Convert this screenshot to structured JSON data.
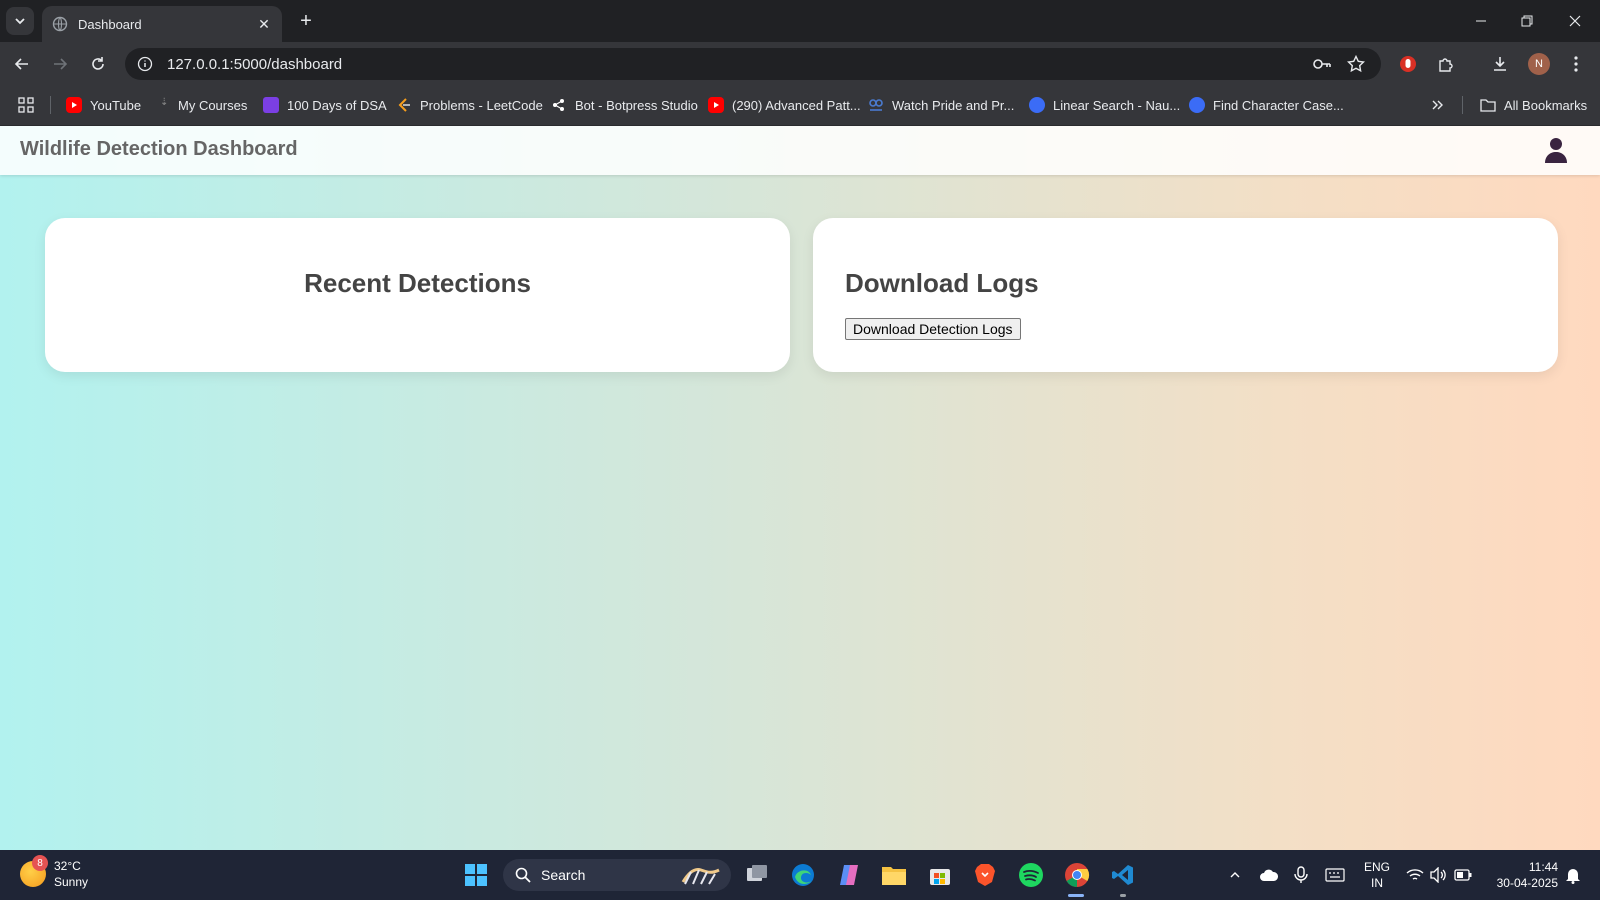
{
  "browser": {
    "tab_title": "Dashboard",
    "url": "127.0.0.1:5000/dashboard",
    "profile_initial": "N",
    "bookmarks": [
      {
        "label": "YouTube",
        "icon": "youtube-icon",
        "color": "#ff0000"
      },
      {
        "label": "My Courses",
        "icon": "courses-icon",
        "color": "#888888"
      },
      {
        "label": "100 Days of DSA",
        "icon": "dsa-icon",
        "color": "#7b3fe4"
      },
      {
        "label": "Problems - LeetCode",
        "icon": "leetcode-icon",
        "color": "#f89f1b"
      },
      {
        "label": "Bot - Botpress Studio",
        "icon": "botpress-icon",
        "color": "#ffffff"
      },
      {
        "label": "(290) Advanced Patt...",
        "icon": "youtube-icon",
        "color": "#ff0000"
      },
      {
        "label": "Watch Pride and Pr...",
        "icon": "watch-icon",
        "color": "#4a7bd0"
      },
      {
        "label": "Linear Search - Nau...",
        "icon": "naukri-icon",
        "color": "#3b6cf6"
      },
      {
        "label": "Find Character Case...",
        "icon": "naukri-icon",
        "color": "#3b6cf6"
      }
    ],
    "all_bookmarks": "All Bookmarks"
  },
  "app": {
    "title": "Wildlife Detection Dashboard",
    "cards": {
      "recent_title": "Recent Detections",
      "download_title": "Download Logs",
      "download_button": "Download Detection Logs"
    }
  },
  "taskbar": {
    "weather_temp": "32°C",
    "weather_desc": "Sunny",
    "weather_badge": "8",
    "search_label": "Search",
    "lang_line1": "ENG",
    "lang_line2": "IN",
    "time": "11:44",
    "date": "30-04-2025"
  },
  "colors": {
    "accent": "#8ab4f8",
    "page_gradient_start": "#b2f2ef",
    "page_gradient_end": "#ffd9bf"
  }
}
